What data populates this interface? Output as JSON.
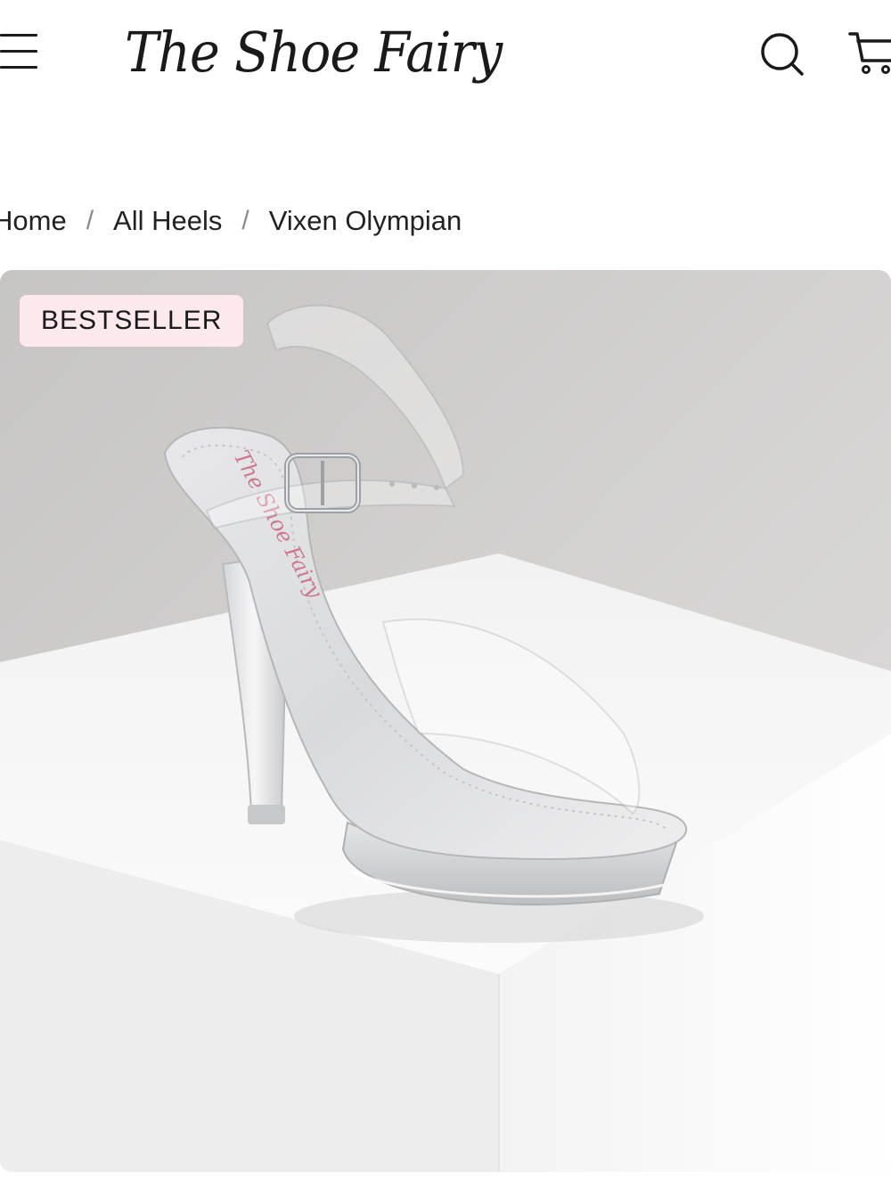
{
  "header": {
    "logo_text": "The Shoe Fairy"
  },
  "breadcrumb": {
    "items": [
      "Home",
      "All Heels",
      "Vixen Olympian"
    ],
    "separator": "/"
  },
  "product": {
    "badge": "BESTSELLER",
    "insole_brand_text": "The Shoe Fairy",
    "image_description_icon": "clear-heel-sandal-image"
  },
  "colors": {
    "badge_bg": "#fbe9ee",
    "text": "#1a1a1a",
    "separator": "#8a8a8a",
    "insole_brand": "#c9667f"
  },
  "icons": {
    "menu": "hamburger-menu-icon",
    "search": "search-icon",
    "cart": "shopping-cart-icon"
  }
}
